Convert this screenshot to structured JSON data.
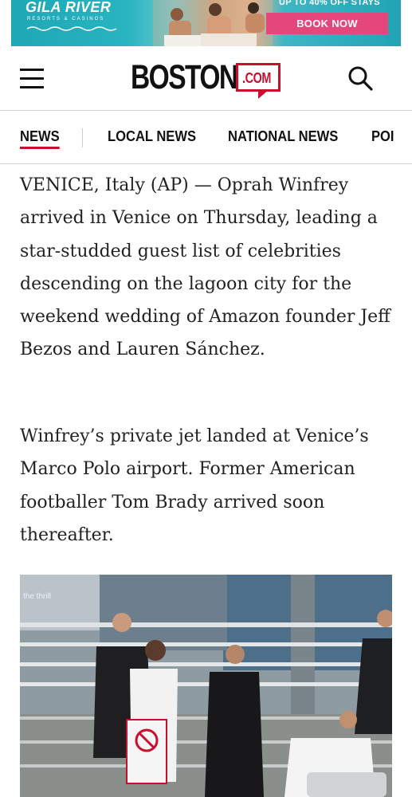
{
  "ad": {
    "brand": "GILA RIVER",
    "subtitle": "RESORTS & CASINOS",
    "offer": "UP TO 40% OFF STAYS",
    "cta": "BOOK NOW"
  },
  "header": {
    "logo_main": "BOSTON",
    "logo_suffix": ".COM"
  },
  "nav": {
    "items": [
      {
        "label": "NEWS",
        "active": true
      },
      {
        "label": "LOCAL NEWS",
        "active": false
      },
      {
        "label": "NATIONAL NEWS",
        "active": false
      },
      {
        "label": "POI",
        "active": false
      }
    ]
  },
  "article": {
    "paragraphs": [
      "VENICE, Italy (AP) — Oprah Winfrey arrived in Venice on Thursday, leading a star-studded guest list of celebrities descending on the lagoon city for the weekend wedding of Amazon founder Jeff Bezos and Lauren Sánchez.",
      "Winfrey’s private jet landed at Venice’s Marco Polo airport. Former American footballer Tom Brady arrived soon thereafter."
    ]
  },
  "photo": {
    "background_text": "the thrill"
  },
  "colors": {
    "brand_red": "#c8102e",
    "ad_cta": "#e5467c",
    "ad_teal": "#21a3b4"
  }
}
